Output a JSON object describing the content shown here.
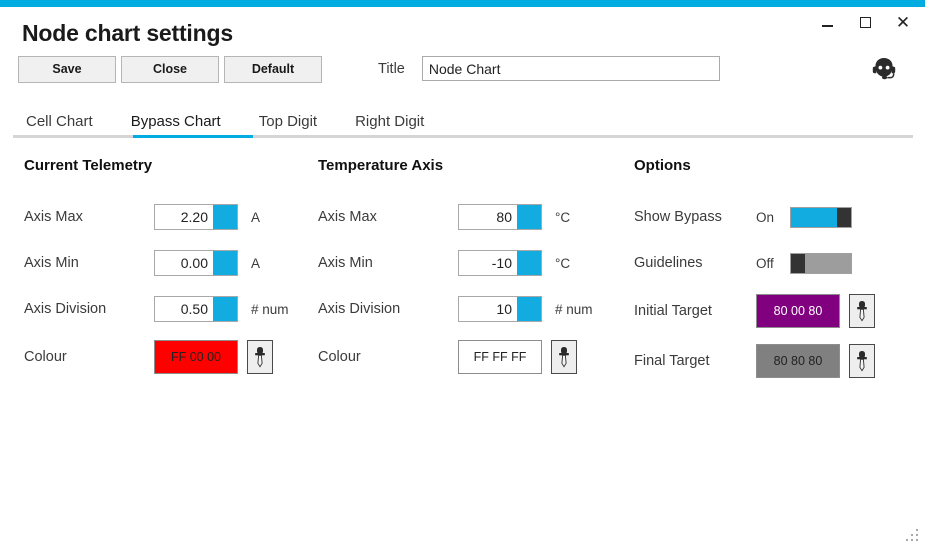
{
  "window": {
    "title": "Node chart settings",
    "accent_color": "#00ace0",
    "controls": {
      "minimize": "minimize-icon",
      "maximize": "maximize-icon",
      "close": "close-icon"
    },
    "avatar_icon": "support-agent-headset-icon"
  },
  "toolbar": {
    "save_label": "Save",
    "close_label": "Close",
    "default_label": "Default",
    "title_label": "Title",
    "title_value": "Node Chart",
    "title_placeholder": ""
  },
  "tabs": [
    {
      "label": "Cell Chart",
      "active": false
    },
    {
      "label": "Bypass Chart",
      "active": true
    },
    {
      "label": "Top Digit",
      "active": false
    },
    {
      "label": "Right Digit",
      "active": false
    }
  ],
  "current_telemetry": {
    "section_title": "Current Telemetry",
    "axis_max": {
      "label": "Axis Max",
      "value": "2.20",
      "unit": "A"
    },
    "axis_min": {
      "label": "Axis Min",
      "value": "0.00",
      "unit": "A"
    },
    "axis_division": {
      "label": "Axis Division",
      "value": "0.50",
      "unit": "# num"
    },
    "colour": {
      "label": "Colour",
      "value": "FF 00 00",
      "hex": "#FF0000",
      "text_color": "#222222",
      "picker_icon": "eyedropper-icon"
    }
  },
  "temperature_axis": {
    "section_title": "Temperature Axis",
    "axis_max": {
      "label": "Axis Max",
      "value": "80",
      "unit": "°C"
    },
    "axis_min": {
      "label": "Axis Min",
      "value": "-10",
      "unit": "°C"
    },
    "axis_division": {
      "label": "Axis Division",
      "value": "10",
      "unit": "# num"
    },
    "colour": {
      "label": "Colour",
      "value": "FF FF FF",
      "hex": "#FFFFFF",
      "text_color": "#222222",
      "picker_icon": "eyedropper-icon"
    }
  },
  "options": {
    "section_title": "Options",
    "show_bypass": {
      "label": "Show Bypass",
      "state": "On",
      "on": true
    },
    "guidelines": {
      "label": "Guidelines",
      "state": "Off",
      "on": false
    },
    "initial_target": {
      "label": "Initial Target",
      "value": "80 00 80",
      "hex": "#800080",
      "text_color": "#FFFFFF",
      "picker_icon": "eyedropper-icon"
    },
    "final_target": {
      "label": "Final Target",
      "value": "80 80 80",
      "hex": "#808080",
      "text_color": "#222222",
      "picker_icon": "eyedropper-icon"
    }
  },
  "status": {
    "resize_grip": "resize-grip-icon"
  }
}
